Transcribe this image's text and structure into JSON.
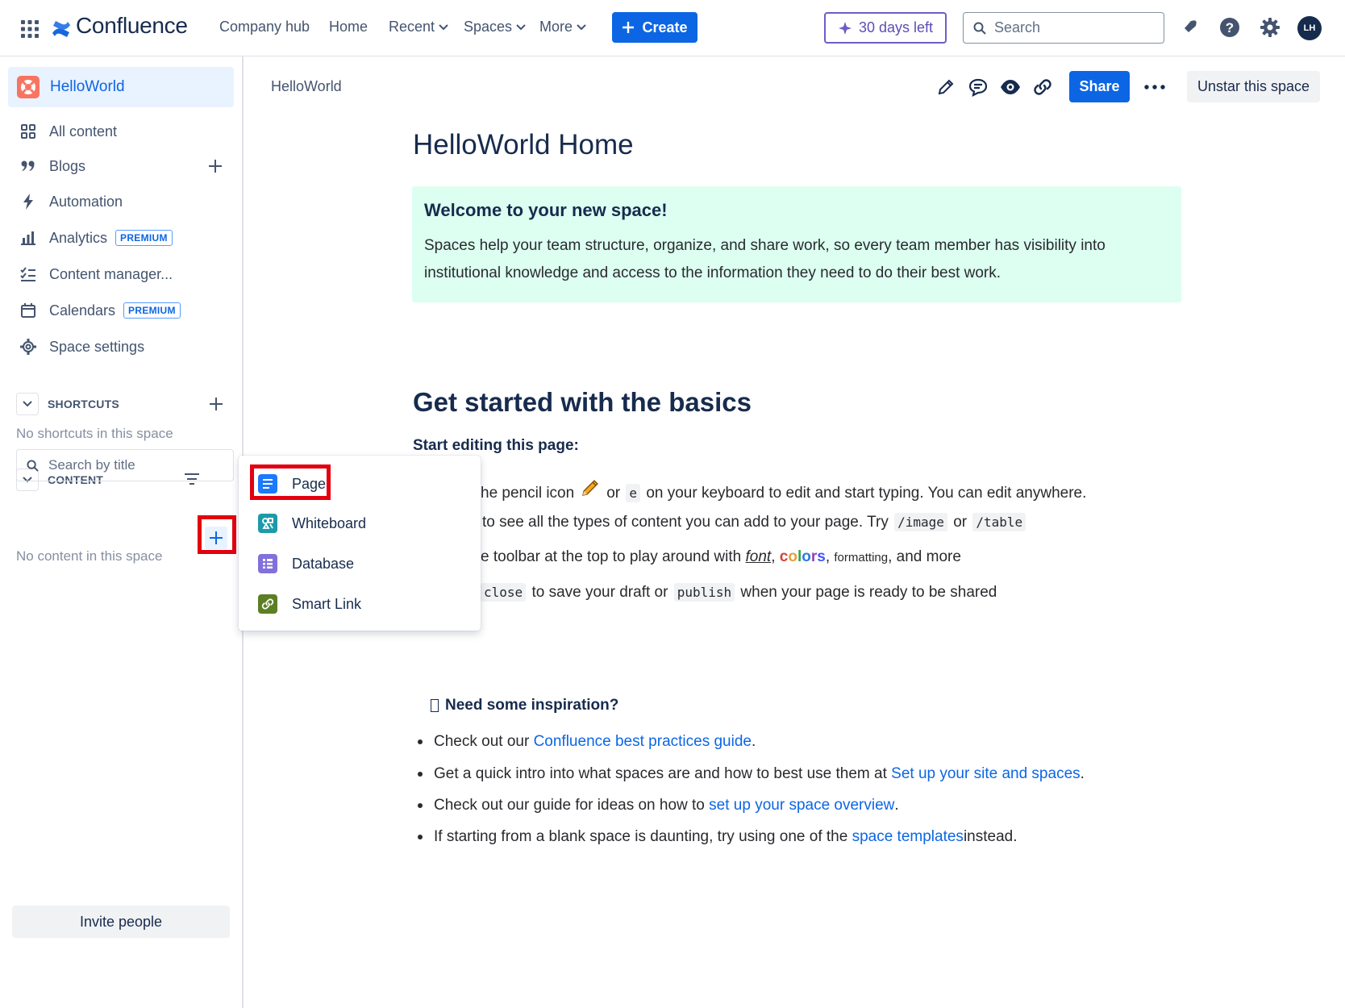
{
  "topbar": {
    "product_name": "Confluence",
    "nav": [
      "Company hub",
      "Home",
      "Recent",
      "Spaces",
      "More"
    ],
    "create_label": "Create",
    "trial_label": "30 days left",
    "search_placeholder": "Search",
    "avatar_initials": "LH",
    "accent_color": "#0c66e4"
  },
  "sidebar": {
    "space_name": "HelloWorld",
    "items": [
      {
        "label": "All content",
        "icon": "grid-icon"
      },
      {
        "label": "Blogs",
        "icon": "quote-icon"
      },
      {
        "label": "Automation",
        "icon": "lightning-icon"
      },
      {
        "label": "Analytics",
        "icon": "bar-chart-icon",
        "badge": "PREMIUM"
      },
      {
        "label": "Content manager...",
        "icon": "checklist-icon"
      },
      {
        "label": "Calendars",
        "icon": "calendar-icon",
        "badge": "PREMIUM"
      },
      {
        "label": "Space settings",
        "icon": "gear-icon"
      }
    ],
    "shortcuts_title": "SHORTCUTS",
    "shortcuts_empty": "No shortcuts in this space",
    "content_title": "CONTENT",
    "content_search_placeholder": "Search by title",
    "content_empty": "No content in this space",
    "invite_label": "Invite people"
  },
  "dropdown": {
    "items": [
      {
        "label": "Page",
        "icon": "page-icon",
        "color": "#1d7afc"
      },
      {
        "label": "Whiteboard",
        "icon": "whiteboard-icon",
        "color": "#1d9aaa"
      },
      {
        "label": "Database",
        "icon": "database-icon",
        "color": "#8270db"
      },
      {
        "label": "Smart Link",
        "icon": "smart-link-icon",
        "color": "#5b7f24"
      }
    ]
  },
  "main": {
    "breadcrumb": "HelloWorld",
    "share_label": "Share",
    "unstar_label": "Unstar this space",
    "title": "HelloWorld Home",
    "panel": {
      "title": "Welcome to your new space!",
      "body": "Spaces help your team structure, organize, and share work, so every team member has visibility into institutional knowledge and access to the information they need to do their best work."
    },
    "basics_heading": "Get started with the basics",
    "start_editing": "Start editing this page:",
    "lines": {
      "l1_a": "he pencil icon",
      "l1_b": "or",
      "l1_code": "e",
      "l1_c": "on your keyboard to edit and start typing. You can edit anywhere.",
      "l2_a": "to see all the types of content you can add to your page. Try",
      "l2_code1": "/image",
      "l2_b": "or",
      "l2_code2": "/table",
      "l3_a": "e toolbar at the top to play around with",
      "l3_font": "font",
      "l3_comma": ",",
      "l3_colors": "colors",
      "l3_sup": "formatt",
      "l3_sub": "ing",
      "l3_b": ", and more",
      "l4_code1": "close",
      "l4_a": "to save your draft or",
      "l4_code2": "publish",
      "l4_b": "when your page is ready to be shared"
    },
    "inspiration_heading": "Need some inspiration?",
    "bullets": [
      {
        "pre": "Check out our ",
        "link": "Confluence best practices guide",
        "post": "."
      },
      {
        "pre": "Get a quick intro into what spaces are and how to best use them at ",
        "link": "Set up your site and spaces",
        "post": "."
      },
      {
        "pre": "Check out our guide for ideas on how to ",
        "link": "set up your space overview",
        "post": "."
      },
      {
        "pre": "If starting from a blank space is daunting, try using one of the ",
        "link": "space templates",
        "post": " instead."
      }
    ]
  }
}
